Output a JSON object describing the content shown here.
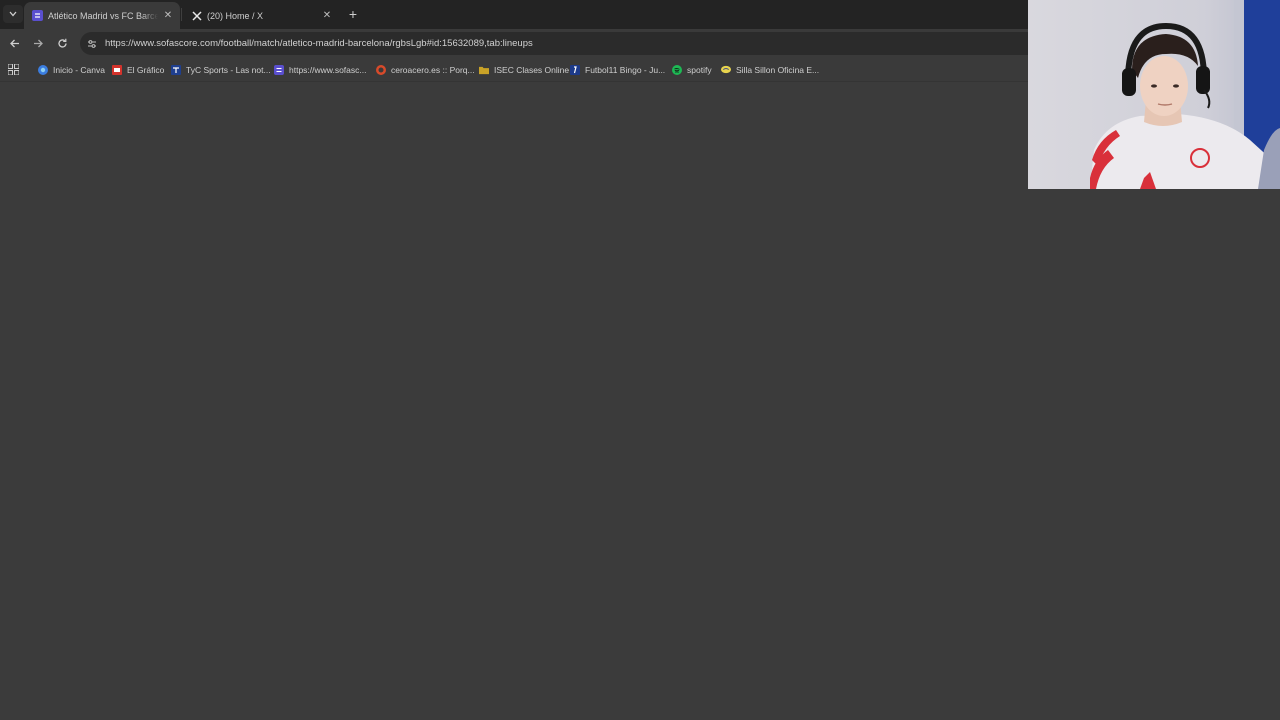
{
  "browser": {
    "tabs": [
      {
        "title": "Atlético Madrid vs FC Barcelona",
        "favicon": "sofascore-icon",
        "active": true
      },
      {
        "title": "(20) Home / X",
        "favicon": "x-logo-icon",
        "active": false
      }
    ],
    "address_bar": {
      "url": "https://www.sofascore.com/football/match/atletico-madrid-barcelona/rgbsLgb#id:15632089,tab:lineups"
    },
    "bookmarks": [
      {
        "label": "Inicio - Canva",
        "icon": "canva-icon",
        "color": "#3b7de0"
      },
      {
        "label": "El Gráfico",
        "icon": "el-grafico-icon",
        "color": "#d4332c"
      },
      {
        "label": "TyC Sports - Las not...",
        "icon": "tyc-icon",
        "color": "#1f3f8f"
      },
      {
        "label": "https://www.sofasc...",
        "icon": "sofascore-icon",
        "color": "#5a4fcf"
      },
      {
        "label": "ceroacero.es :: Porq...",
        "icon": "ceroacero-icon",
        "color": "#d84a2a"
      },
      {
        "label": "ISEC Clases Online",
        "icon": "folder-icon",
        "color": "#c9a227"
      },
      {
        "label": "Futbol11 Bingo - Ju...",
        "icon": "futbol11-icon",
        "color": "#1c3a8a"
      },
      {
        "label": "spotify",
        "icon": "spotify-icon",
        "color": "#1db954"
      },
      {
        "label": "Silla Sillon Oficina E...",
        "icon": "mercadolibre-icon",
        "color": "#e8d44d"
      }
    ]
  },
  "webcam": {
    "description_icon": "webcam-overlay"
  },
  "colors": {
    "tabstrip": "#232323",
    "toolbar": "#3a3a3a",
    "content": "#3b3b3b",
    "omnibox": "#2b2b2b"
  }
}
